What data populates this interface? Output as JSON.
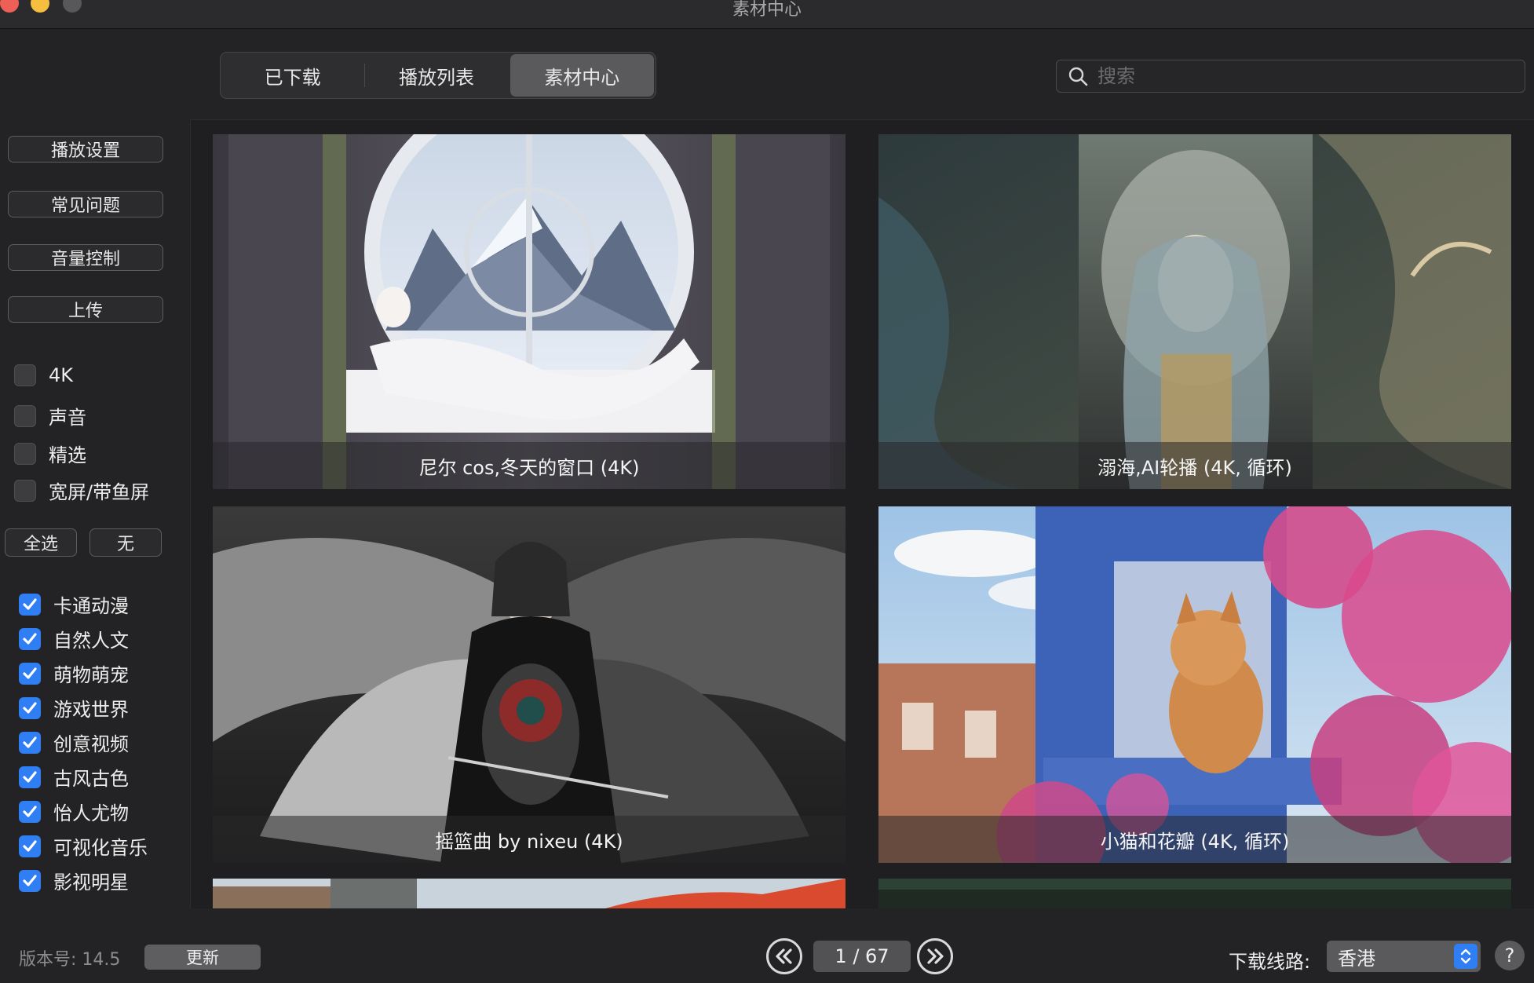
{
  "window": {
    "title": "素材中心"
  },
  "tabs": [
    {
      "label": "已下载",
      "active": false
    },
    {
      "label": "播放列表",
      "active": false
    },
    {
      "label": "素材中心",
      "active": true
    }
  ],
  "search": {
    "placeholder": "搜索",
    "value": ""
  },
  "sidebar": {
    "buttons": [
      {
        "label": "播放设置"
      },
      {
        "label": "常见问题"
      },
      {
        "label": "音量控制"
      },
      {
        "label": "上传"
      }
    ],
    "filters": [
      {
        "label": "4K",
        "checked": false
      },
      {
        "label": "声音",
        "checked": false
      },
      {
        "label": "精选",
        "checked": false
      },
      {
        "label": "宽屏/带鱼屏",
        "checked": false
      }
    ],
    "select_all_label": "全选",
    "select_none_label": "无",
    "categories": [
      {
        "label": "卡通动漫",
        "checked": true
      },
      {
        "label": "自然人文",
        "checked": true
      },
      {
        "label": "萌物萌宠",
        "checked": true
      },
      {
        "label": "游戏世界",
        "checked": true
      },
      {
        "label": "创意视频",
        "checked": true
      },
      {
        "label": "古风古色",
        "checked": true
      },
      {
        "label": "怡人尤物",
        "checked": true
      },
      {
        "label": "可视化音乐",
        "checked": true
      },
      {
        "label": "影视明星",
        "checked": true
      }
    ]
  },
  "items": [
    {
      "title": "尼尔 cos,冬天的窗口 (4K)"
    },
    {
      "title": "溺海,AI轮播 (4K, 循环)"
    },
    {
      "title": "摇篮曲 by nixeu (4K)"
    },
    {
      "title": "小猫和花瓣 (4K, 循环)"
    }
  ],
  "footer": {
    "version": "版本号: 14.5",
    "update_label": "更新",
    "page_indicator": "1 / 67",
    "download_route_label": "下载线路:",
    "download_route_value": "香港",
    "help_label": "?"
  },
  "colors": {
    "accent": "#2f7ef4",
    "background": "#232325",
    "panel": "#1f1f21"
  }
}
